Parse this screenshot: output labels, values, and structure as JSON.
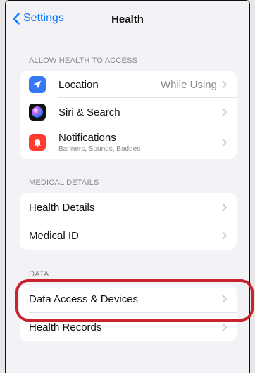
{
  "nav": {
    "back_label": "Settings",
    "title": "Health"
  },
  "sections": {
    "access": {
      "header": "ALLOW HEALTH TO ACCESS",
      "location": {
        "label": "Location",
        "value": "While Using",
        "icon": "location-arrow-icon",
        "color": "#3478f6"
      },
      "siri": {
        "label": "Siri & Search",
        "icon": "siri-icon"
      },
      "notifications": {
        "label": "Notifications",
        "sublabel": "Banners, Sounds, Badges",
        "icon": "notification-bell-icon",
        "color": "#ff3b30"
      }
    },
    "medical": {
      "header": "MEDICAL DETAILS",
      "health_details": {
        "label": "Health Details"
      },
      "medical_id": {
        "label": "Medical ID"
      }
    },
    "data": {
      "header": "DATA",
      "data_access": {
        "label": "Data Access & Devices"
      },
      "health_records": {
        "label": "Health Records"
      }
    }
  },
  "colors": {
    "accent": "#0a7aff",
    "highlight": "#c8232c"
  }
}
